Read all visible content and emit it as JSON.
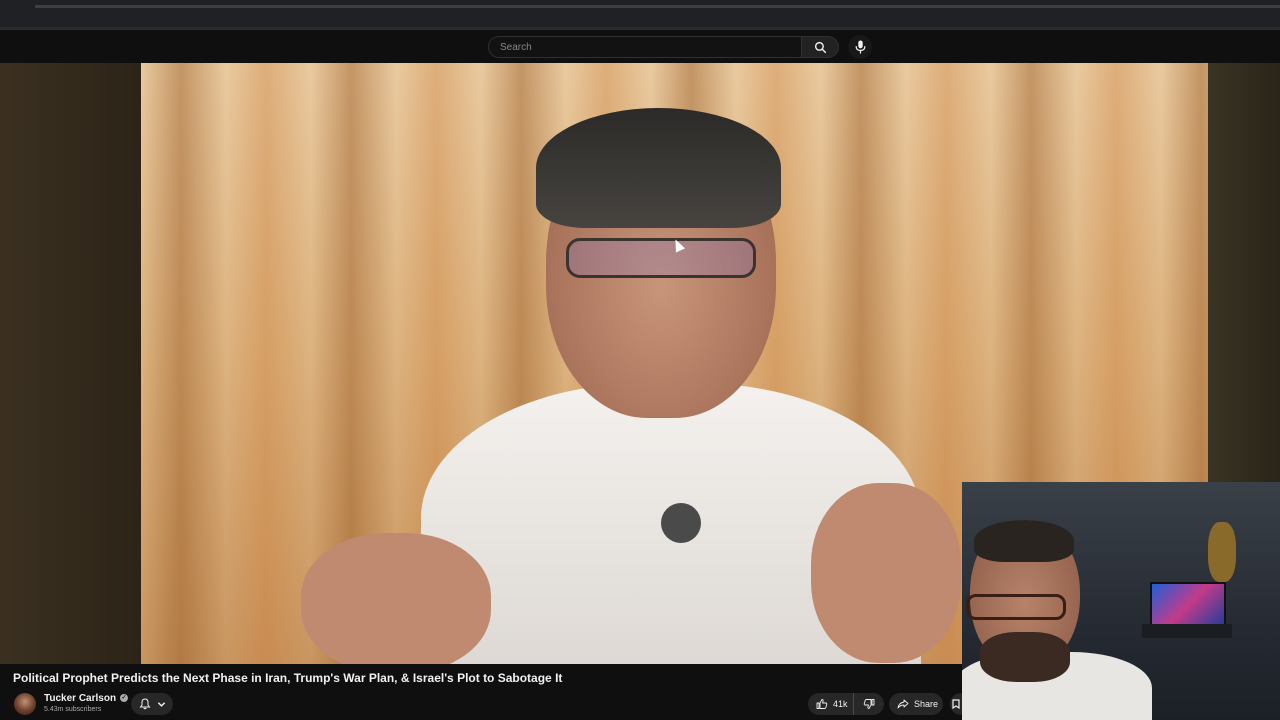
{
  "masthead": {
    "search_placeholder": "Search",
    "search_icon": "search-icon",
    "mic_icon": "microphone-icon"
  },
  "video": {
    "title": "Political Prophet Predicts the Next Phase in Iran, Trump's War Plan, & Israel's Plot to Sabotage It"
  },
  "channel": {
    "name": "Tucker Carlson",
    "verified_icon": "verified-check-icon",
    "subscribers": "5.43m subscribers"
  },
  "actions": {
    "bell_icon": "bell-icon",
    "chevron_icon": "chevron-down-icon",
    "like_count": "41k",
    "like_icon": "thumbs-up-icon",
    "dislike_icon": "thumbs-down-icon",
    "share_label": "Share",
    "share_icon": "share-icon"
  },
  "colors": {
    "background": "#0f0f0f",
    "button_bg": "#272727",
    "text_primary": "#f1f1f1",
    "text_secondary": "#aaaaaa"
  }
}
